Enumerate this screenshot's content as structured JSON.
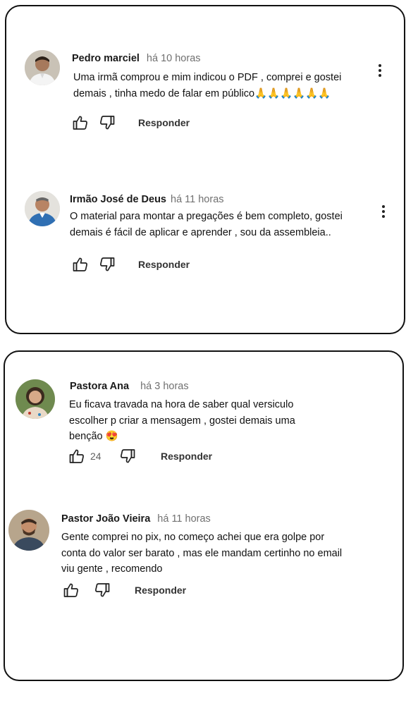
{
  "comments": [
    {
      "author": "Pedro marciel",
      "time": "há 10 horas",
      "lines": [
        "Uma irmã comprou e mim indicou o PDF , comprei e gostei",
        "demais , tinha medo de falar em público🙏🙏🙏🙏🙏🙏"
      ],
      "like_count": "",
      "reply_label": "Responder"
    },
    {
      "author": "Irmão José de Deus",
      "time": "há 11 horas",
      "lines": [
        "O material para montar a pregações é bem completo, gostei",
        "demais é fácil de aplicar e aprender , sou da assembleia.."
      ],
      "like_count": "",
      "reply_label": "Responder"
    },
    {
      "author": "Pastora Ana",
      "time": "há 3 horas",
      "lines": [
        "Eu ficava travada na hora de saber qual versiculo",
        "escolher p criar a mensagem , gostei demais uma",
        "benção 😍"
      ],
      "like_count": "24",
      "reply_label": "Responder"
    },
    {
      "author": "Pastor João Vieira",
      "time": "há 11 horas",
      "lines": [
        "Gente comprei no pix, no começo achei que era golpe por",
        "conta do valor ser barato , mas ele mandam certinho no email",
        "viu gente , recomendo"
      ],
      "like_count": "",
      "reply_label": "Responder"
    }
  ],
  "icons": {
    "like": "thumbs-up-icon",
    "dislike": "thumbs-down-icon",
    "menu": "more-vert-icon"
  },
  "colors": {
    "text": "#0f0f0f",
    "meta": "#707070",
    "border": "#111111"
  }
}
